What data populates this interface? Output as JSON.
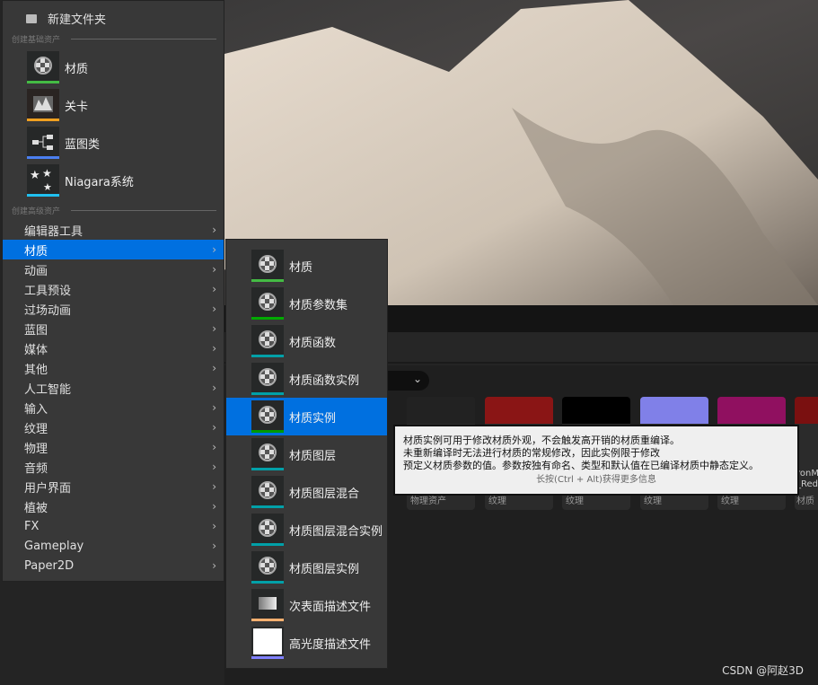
{
  "menu": {
    "top_item": "新建文件夹",
    "section_basic": "创建基础资产",
    "basic": [
      {
        "label": "材质",
        "color": "#44bb44"
      },
      {
        "label": "关卡",
        "color": "#f0a020"
      },
      {
        "label": "蓝图类",
        "color": "#4a7ff0"
      },
      {
        "label": "Niagara系统",
        "color": "#20c0f0"
      }
    ],
    "section_advanced": "创建高级资产",
    "items": [
      "编辑器工具",
      "材质",
      "动画",
      "工具预设",
      "过场动画",
      "蓝图",
      "媒体",
      "其他",
      "人工智能",
      "输入",
      "纹理",
      "物理",
      "音频",
      "用户界面",
      "植被",
      "FX",
      "Gameplay",
      "Paper2D"
    ],
    "selected": "材质"
  },
  "submenu": {
    "items": [
      {
        "label": "材质",
        "color": "#44bb44",
        "icon": "material-icon"
      },
      {
        "label": "材质参数集",
        "color": "#00aa00",
        "icon": "parameter-collection-icon"
      },
      {
        "label": "材质函数",
        "color": "#00a0a8",
        "icon": "material-function-icon"
      },
      {
        "label": "材质函数实例",
        "color": "#00a0a8",
        "icon": "function-instance-icon"
      },
      {
        "label": "材质实例",
        "color": "#009900",
        "icon": "material-instance-icon"
      },
      {
        "label": "材质图层",
        "color": "#00a0a8",
        "icon": "material-layer-icon"
      },
      {
        "label": "材质图层混合",
        "color": "#00a0a8",
        "icon": "layer-blend-icon"
      },
      {
        "label": "材质图层混合实例",
        "color": "#00a0a8",
        "icon": "layer-blend-instance-icon"
      },
      {
        "label": "材质图层实例",
        "color": "#00a0a8",
        "icon": "layer-instance-icon"
      },
      {
        "label": "次表面描述文件",
        "color": "#ffb070",
        "icon": "subsurface-profile-icon"
      },
      {
        "label": "高光度描述文件",
        "color": "#8080ff",
        "icon": "specular-profile-icon"
      }
    ],
    "selected": "材质实例"
  },
  "tooltip": {
    "lines": [
      "材质实例可用于修改材质外观，不会触发高开销的材质重编译。",
      "未重新编译时无法进行材质的常规修改，因此实例限于修改",
      "预定义材质参数的值。参数按独有命名、类型和默认值在已编译材质中静态定义。"
    ],
    "hint": "长按(Ctrl + Alt)获得更多信息"
  },
  "assets": [
    {
      "type": "物理资产"
    },
    {
      "type": "纹理"
    },
    {
      "type": "纹理"
    },
    {
      "type": "纹理"
    },
    {
      "type": "纹理"
    },
    {
      "type": "材质",
      "name": "ronM _Red"
    }
  ],
  "watermark": "CSDN @阿赵3D"
}
